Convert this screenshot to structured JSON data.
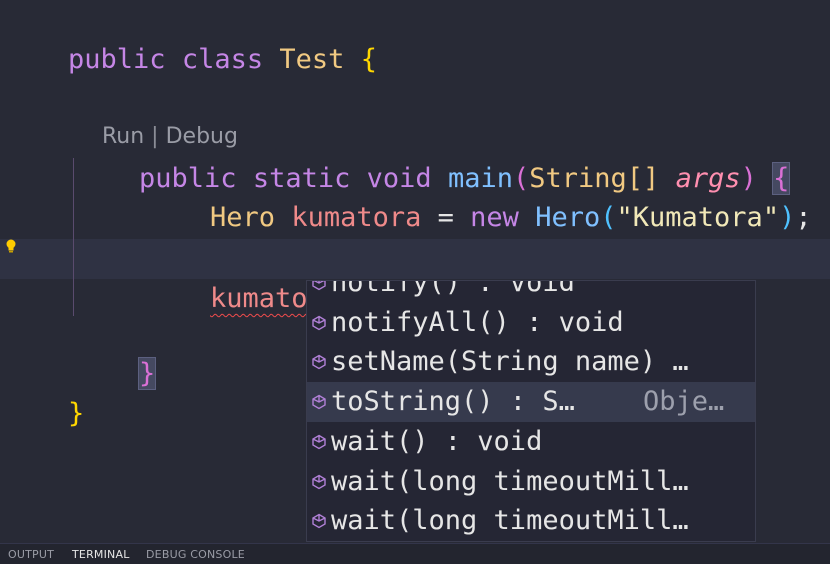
{
  "editor": {
    "code": {
      "line1": {
        "public": "public",
        "class": "class",
        "name": "Test",
        "brace": "{"
      },
      "codelens": {
        "run": "Run",
        "sep": "|",
        "debug": "Debug"
      },
      "line_main": {
        "public": "public",
        "static": "static",
        "void": "void",
        "main": "main",
        "lparen": "(",
        "type": "String[]",
        "param": "args",
        "rparen": ")",
        "brace": "{"
      },
      "line_hero": {
        "type": "Hero",
        "var": "kumatora",
        "eq": "=",
        "new": "new",
        "ctor": "Hero",
        "lparen": "(",
        "str": "\"Kumatora\"",
        "rparen": ")",
        "semi": ";"
      },
      "line_cursor": {
        "var": "kumatora",
        "dot": "."
      },
      "close_method": "}",
      "close_class": "}"
    },
    "lightbulb_icon": "lightbulb-icon"
  },
  "suggest": {
    "items": [
      {
        "label": "notify() : void",
        "detail": ""
      },
      {
        "label": "notifyAll() : void",
        "detail": ""
      },
      {
        "label": "setName(String name) …",
        "detail": ""
      },
      {
        "label": "toString() : S…",
        "detail": "Obje…"
      },
      {
        "label": "wait() : void",
        "detail": ""
      },
      {
        "label": "wait(long timeoutMill…",
        "detail": ""
      },
      {
        "label": "wait(long timeoutMill…",
        "detail": ""
      }
    ],
    "selected_index": 3,
    "item_icon": "method-icon"
  },
  "panel": {
    "tabs": [
      {
        "label": "OUTPUT",
        "active": false
      },
      {
        "label": "TERMINAL",
        "active": true
      },
      {
        "label": "DEBUG CONSOLE",
        "active": false
      }
    ]
  },
  "colors": {
    "background": "#282a36",
    "keyword": "#c586e6",
    "type": "#f1c982",
    "function": "#80c0ff",
    "variable": "#ef8a8a",
    "string": "#f1e8b8",
    "brace_gold": "#ffd700",
    "error_squiggle": "#f14c4c"
  }
}
